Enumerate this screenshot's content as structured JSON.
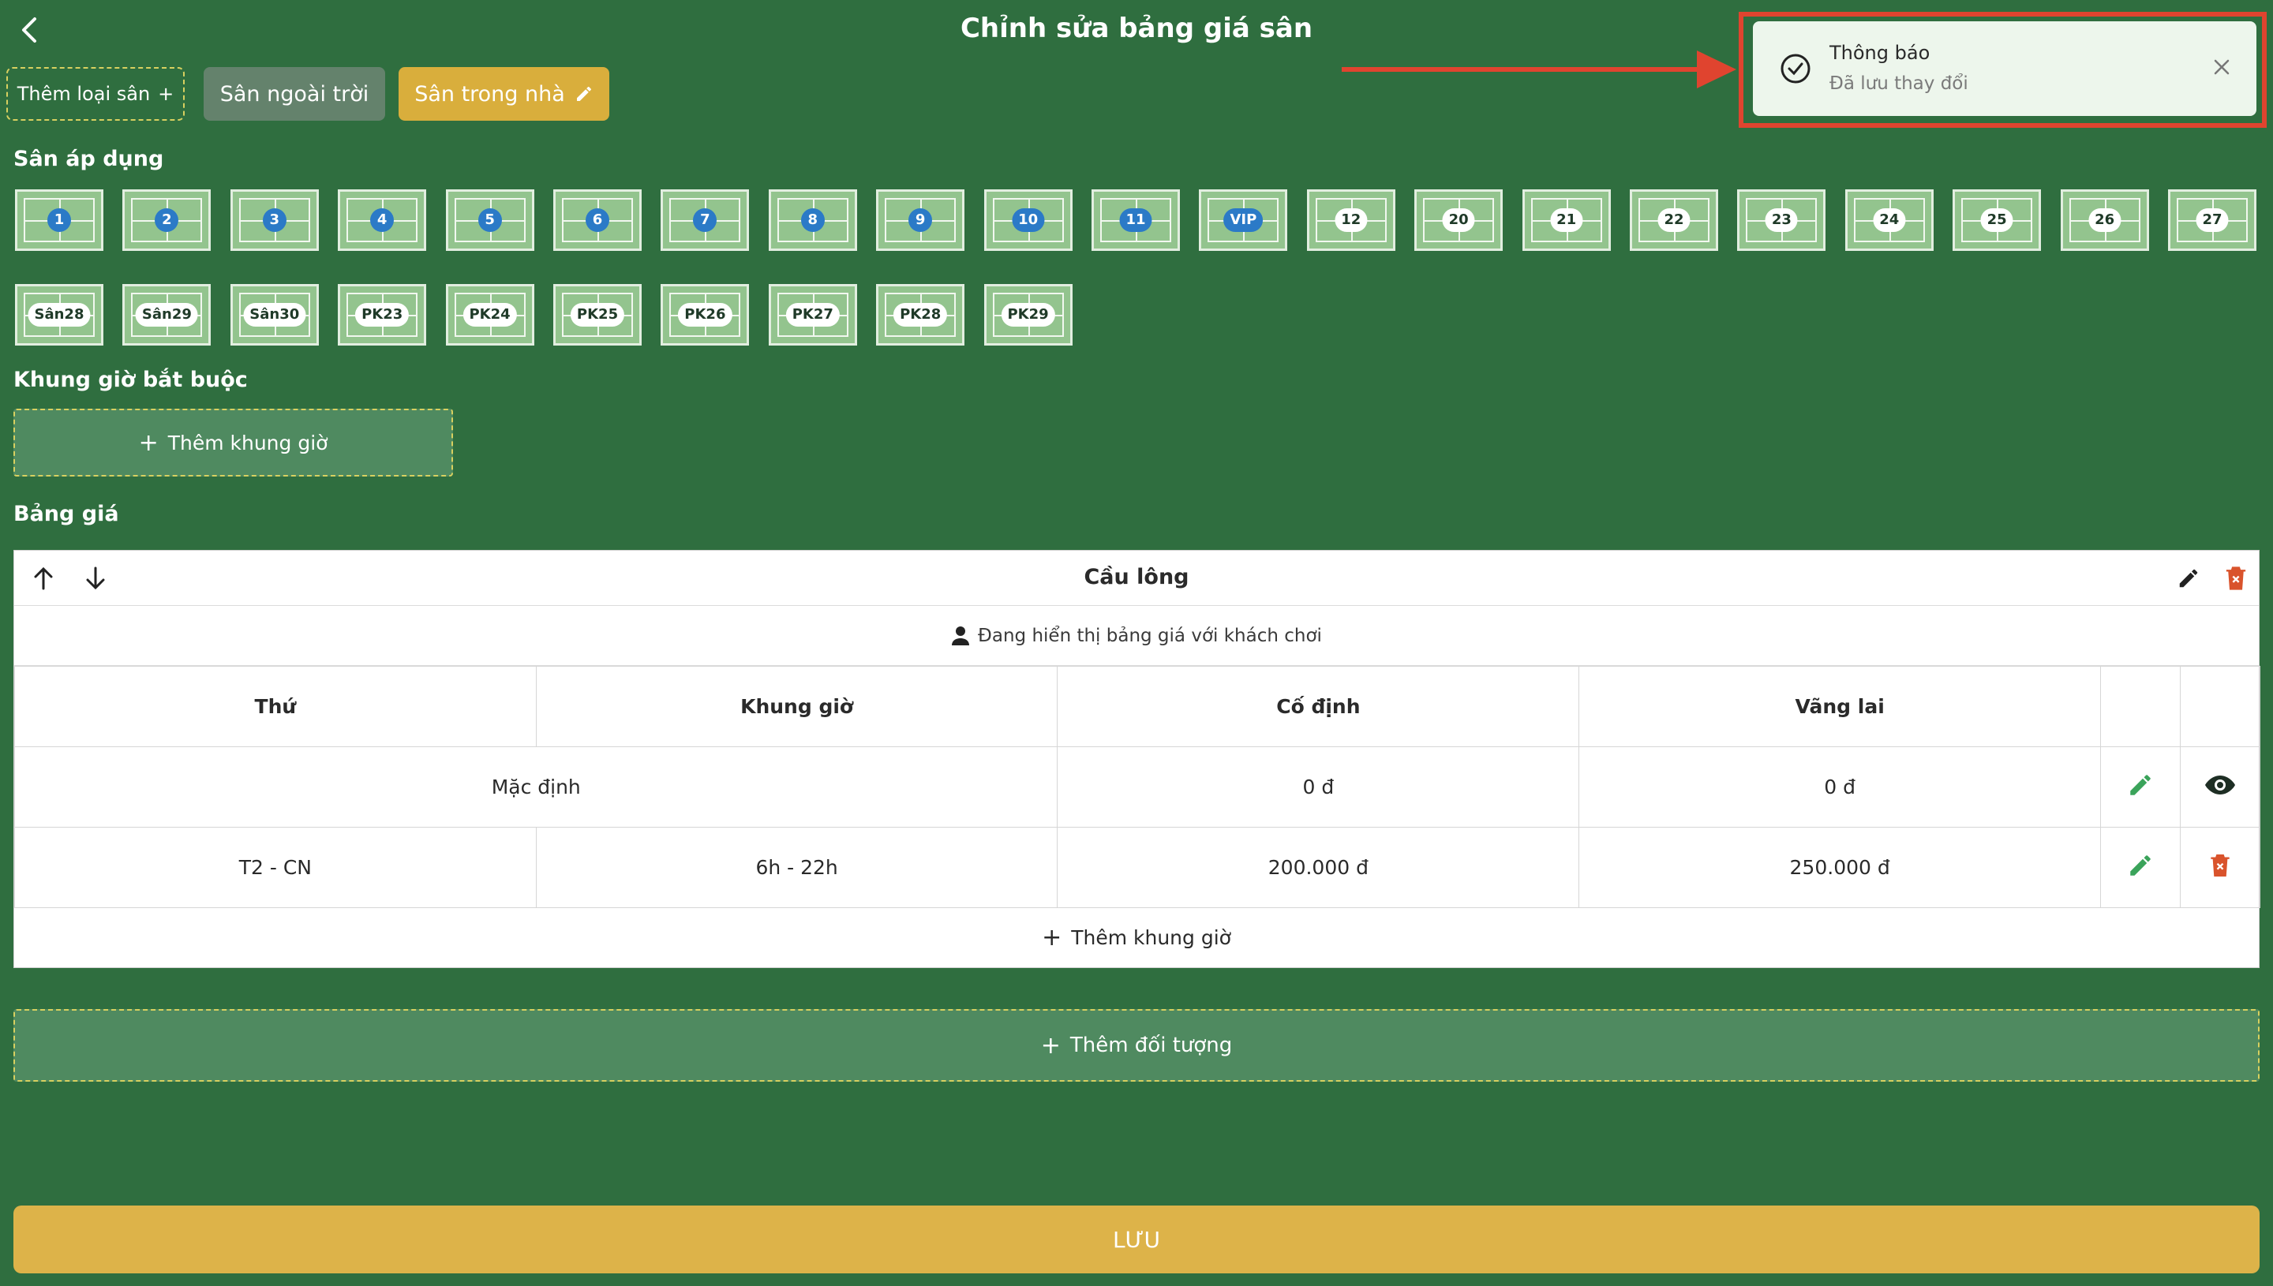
{
  "header": {
    "title": "Chỉnh sửa bảng giá sân"
  },
  "tabs": {
    "add_label": "Thêm loại sân",
    "outdoor": "Sân ngoài trời",
    "indoor": "Sân trong nhà"
  },
  "sections": {
    "courts": "Sân áp dụng",
    "required_slots": "Khung giờ bắt buộc",
    "price_table": "Bảng giá"
  },
  "courts": {
    "row1": [
      "1",
      "2",
      "3",
      "4",
      "5",
      "6",
      "7",
      "8",
      "9",
      "10",
      "11",
      "VIP",
      "12",
      "20",
      "21",
      "22",
      "23",
      "24",
      "25",
      "26",
      "27"
    ],
    "row2": [
      "Sân28",
      "Sân29",
      "Sân30",
      "PK23",
      "PK24",
      "PK25",
      "PK26",
      "PK27",
      "PK28",
      "PK29"
    ]
  },
  "add_slot_label": "Thêm khung giờ",
  "card": {
    "title": "Cầu lông",
    "info": "Đang hiển thị bảng giá với khách chơi",
    "columns": [
      "Thứ",
      "Khung giờ",
      "Cố định",
      "Vãng lai"
    ],
    "default_row": {
      "label": "Mặc định",
      "fixed": "0 đ",
      "walkin": "0 đ"
    },
    "rows": [
      {
        "day": "T2 - CN",
        "time": "6h - 22h",
        "fixed": "200.000 đ",
        "walkin": "250.000 đ"
      }
    ],
    "add_row_label": "Thêm khung giờ"
  },
  "add_object_label": "Thêm đối tượng",
  "save_label": "LƯU",
  "toast": {
    "title": "Thông báo",
    "message": "Đã lưu thay đổi"
  },
  "colors": {
    "background": "#2f6e3f",
    "accent_gold": "#ddb349",
    "court_blue": "#2b7ac7",
    "annotation_red": "#e0442f"
  }
}
